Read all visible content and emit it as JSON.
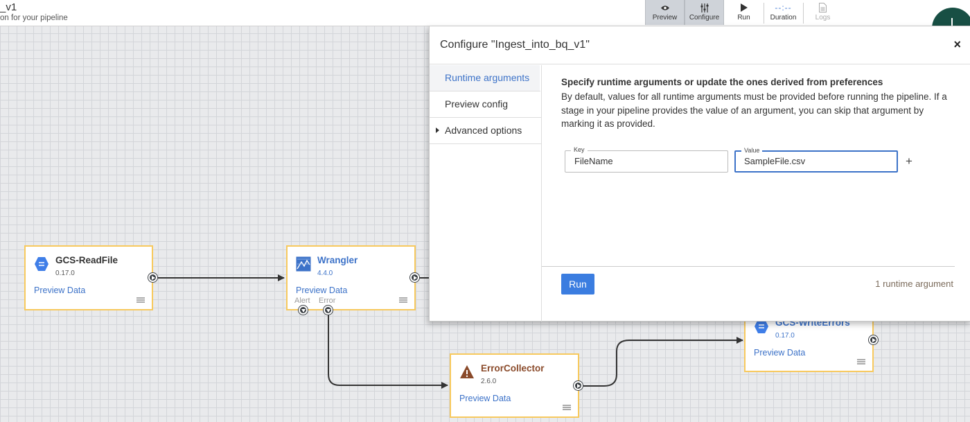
{
  "header": {
    "pipeline_name": "_v1",
    "pipeline_desc": "on for your pipeline",
    "buttons": [
      {
        "label": "Preview",
        "icon": "eye-icon",
        "active": true
      },
      {
        "label": "Configure",
        "icon": "sliders-icon",
        "active": true
      },
      {
        "label": "Run",
        "icon": "play-icon"
      },
      {
        "label": "Duration",
        "value": "--:--"
      },
      {
        "label": "Logs",
        "icon": "document-icon",
        "disabled": true
      }
    ]
  },
  "nodes": {
    "gcs_readfile": {
      "title": "GCS-ReadFile",
      "version": "0.17.0",
      "preview": "Preview Data",
      "icon": "gcs-icon"
    },
    "wrangler": {
      "title": "Wrangler",
      "version": "4.4.0",
      "preview": "Preview Data",
      "alert": "Alert",
      "error": "Error",
      "icon": "wrangler-icon"
    },
    "error_collector": {
      "title": "ErrorCollector",
      "version": "2.6.0",
      "preview": "Preview Data",
      "icon": "warning-icon"
    },
    "gcs_writeerrors": {
      "title": "GCS-WriteErrors",
      "version": "0.17.0",
      "preview": "Preview Data",
      "icon": "gcs-icon"
    }
  },
  "modal": {
    "title": "Configure \"Ingest_into_bq_v1\"",
    "close": "×",
    "sidebar": [
      {
        "label": "Runtime arguments",
        "active": true
      },
      {
        "label": "Preview config"
      },
      {
        "label": "Advanced options",
        "collapsible": true
      }
    ],
    "heading": "Specify runtime arguments or update the ones derived from preferences",
    "description": "By default, values for all runtime arguments must be provided before running the pipeline. If a stage in your pipeline provides the value of an argument, you can skip that argument by marking it as provided.",
    "key_label": "Key",
    "key_value": "FileName",
    "value_label": "Value",
    "value_value": "SampleFile.csv",
    "add": "+",
    "run_label": "Run",
    "runtime_count": "1 runtime argument"
  },
  "colors": {
    "accent": "#3c72c8",
    "run_button": "#3b7de0",
    "node_border": "#f7c95d",
    "error_node_title": "#8a4a2a"
  }
}
